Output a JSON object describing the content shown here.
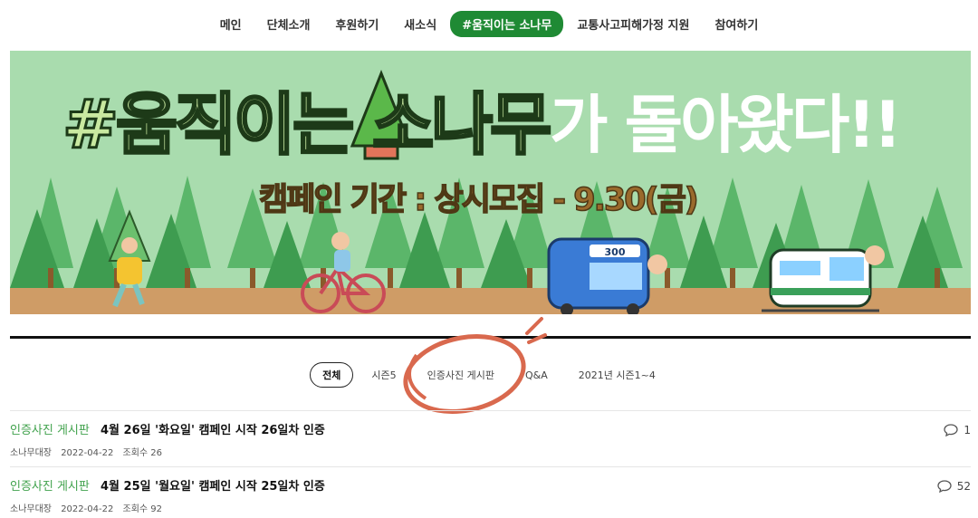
{
  "nav": {
    "items": [
      {
        "label": "메인"
      },
      {
        "label": "단체소개"
      },
      {
        "label": "후원하기"
      },
      {
        "label": "새소식"
      },
      {
        "label": "#움직이는 소나무"
      },
      {
        "label": "교통사고피해가정 지원"
      },
      {
        "label": "참여하기"
      }
    ],
    "active_index": 4
  },
  "banner": {
    "title_dark": "#움직이는 소나무",
    "title_white": "가 돌아왔다!!",
    "subtitle": "캠페인 기간 : 상시모집 - 9.30(금)",
    "bus_number": "300"
  },
  "tabs": {
    "items": [
      {
        "label": "전체"
      },
      {
        "label": "시즌5"
      },
      {
        "label": "인증사진 게시판"
      },
      {
        "label": "Q&A"
      },
      {
        "label": "2021년 시즌1~4"
      }
    ],
    "active_index": 0
  },
  "posts": [
    {
      "category": "인증사진 게시판",
      "title": "4월 26일 '화요일' 캠페인 시작 26일차 인증",
      "author": "소나무대장",
      "date": "2022-04-22",
      "views_label": "조회수 26",
      "comments": "1"
    },
    {
      "category": "인증사진 게시판",
      "title": "4월 25일 '월요일' 캠페인 시작 25일차 인증",
      "author": "소나무대장",
      "date": "2022-04-22",
      "views_label": "조회수 92",
      "comments": "52"
    }
  ],
  "colors": {
    "accent_green": "#1f8a34",
    "category_green": "#41a24d",
    "banner_bg": "#a9dcae",
    "annotation_orange": "#d9694e"
  }
}
